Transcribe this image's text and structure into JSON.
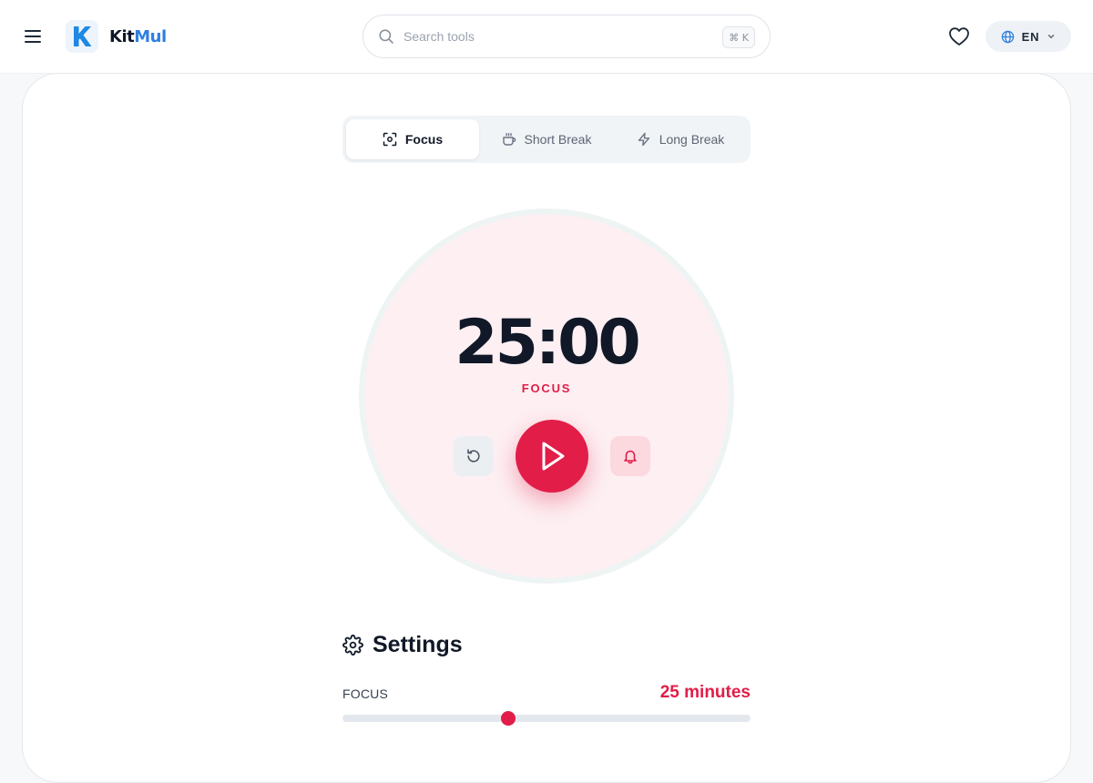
{
  "header": {
    "logo": {
      "kit": "Kit",
      "mul": "Mul"
    },
    "search": {
      "placeholder": "Search tools",
      "shortcut": "⌘ K"
    },
    "language": {
      "code": "EN"
    }
  },
  "tabs": [
    {
      "label": "Focus",
      "icon": "focus-icon",
      "active": true
    },
    {
      "label": "Short Break",
      "icon": "coffee-icon",
      "active": false
    },
    {
      "label": "Long Break",
      "icon": "zap-icon",
      "active": false
    }
  ],
  "timer": {
    "time": "25:00",
    "mode": "FOCUS"
  },
  "settings": {
    "title": "Settings",
    "focus": {
      "label": "FOCUS",
      "value_text": "25 minutes",
      "minutes": 25,
      "min": 1,
      "max": 60
    }
  },
  "colors": {
    "accent": "#e11d48",
    "timer_face": "#fdeff2",
    "logo_blue": "#2f7fe0"
  }
}
